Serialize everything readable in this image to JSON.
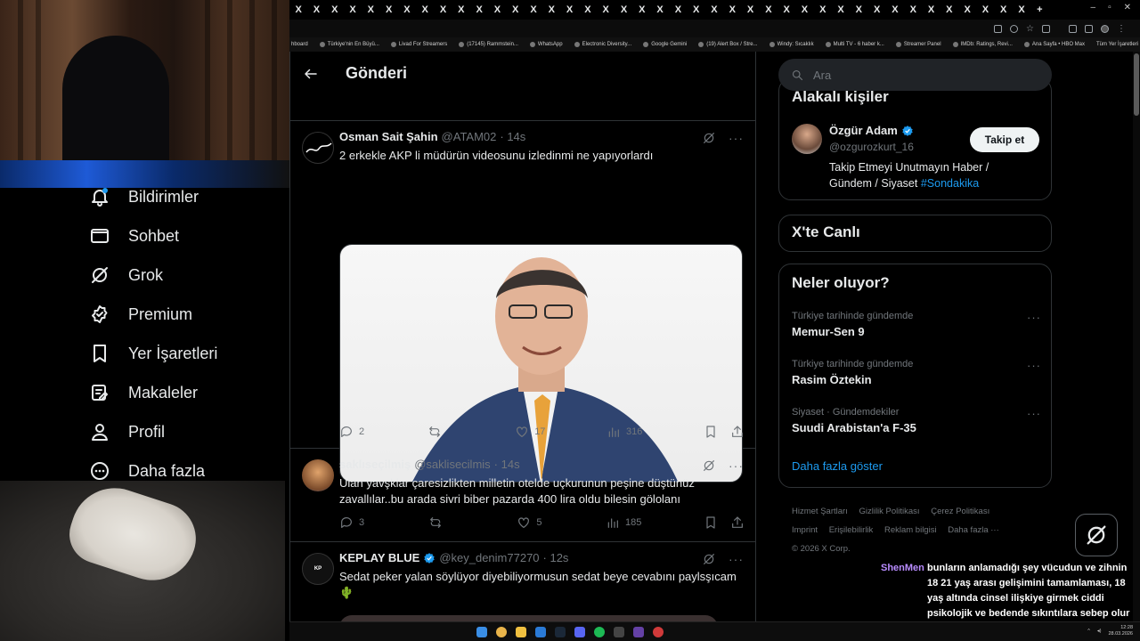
{
  "browser": {
    "tab_close_glyph": "X",
    "new_tab_glyph": "+",
    "window_controls": [
      "–",
      "▫",
      "✕"
    ],
    "bookmarks": [
      "hboard",
      "Türkiye'nin En Büyü...",
      "Livad For Streamers",
      "(17145) Rammstein...",
      "WhatsApp",
      "Electronic Diversity...",
      "Google Gemini",
      "(19) Alert Box / Stre...",
      "Windy: Sıcaklık",
      "Multi TV - 6 haber k...",
      "Streamer Panel",
      "IMDb: Ratings, Revi...",
      "Ana Sayfa • HBO Max"
    ],
    "bookmarks_all": "Tüm Yer İşaretleri"
  },
  "nav": {
    "items": [
      {
        "label": "Bildirimler",
        "icon": "bell-icon"
      },
      {
        "label": "Sohbet",
        "icon": "envelope-icon"
      },
      {
        "label": "Grok",
        "icon": "grok-icon"
      },
      {
        "label": "Premium",
        "icon": "premium-icon"
      },
      {
        "label": "Yer İşaretleri",
        "icon": "bookmark-icon"
      },
      {
        "label": "Makaleler",
        "icon": "articles-icon"
      },
      {
        "label": "Profil",
        "icon": "person-icon"
      },
      {
        "label": "Daha fazla",
        "icon": "more-circle-icon"
      }
    ]
  },
  "header": {
    "title": "Gönderi"
  },
  "tweets": [
    {
      "name": "Osman Sait Şahin",
      "handle": "@ATAM02",
      "time": "· 14s",
      "verified": false,
      "text": "2 erkekle AKP li müdürün videosunu izledinmi ne yapıyorlardı",
      "replies": "2",
      "reposts": "",
      "likes": "17",
      "views": "316"
    },
    {
      "name": "saklıseçilmiş",
      "handle": "@saklisecilmis",
      "time": "· 14s",
      "verified": false,
      "text": "Ulan yavşklar çaresizlikten milletin otelde  uçkurunun peşine düştünüz zavallılar..bu arada sivri biber pazarda 400 lira oldu bilesin gölolanı",
      "replies": "3",
      "reposts": "",
      "likes": "5",
      "views": "185"
    },
    {
      "name": "KEPLAY BLUE",
      "handle": "@key_denim77270",
      "time": "· 12s",
      "verified": true,
      "text": "Sedat peker yalan söylüyor diyebiliyormusun sedat beye cevabını paylsşıcam 🌵"
    }
  ],
  "right": {
    "search_placeholder": "Ara",
    "who_to_follow": {
      "title": "Alakalı kişiler",
      "name": "Özgür Adam",
      "handle": "@ozgurozkurt_16",
      "follow_label": "Takip et",
      "bio": "Takip Etmeyi Unutmayın Haber / Gündem / Siyaset",
      "hashtag": "#Sondakika"
    },
    "live": {
      "title": "X'te Canlı"
    },
    "trends": {
      "title": "Neler oluyor?",
      "items": [
        {
          "context": "Türkiye tarihinde gündemde",
          "name": "Memur-Sen 9"
        },
        {
          "context": "Türkiye tarihinde gündemde",
          "name": "Rasim Öztekin"
        },
        {
          "context": "Siyaset · Gündemdekiler",
          "name": "Suudi Arabistan'a F-35"
        }
      ],
      "show_more": "Daha fazla göster"
    },
    "footer": {
      "links": [
        "Hizmet Şartları",
        "Gizlilik Politikası",
        "Çerez Politikası",
        "Imprint",
        "Erişilebilirlik",
        "Reklam bilgisi",
        "Daha fazla ···"
      ],
      "copyright": "© 2026 X Corp."
    }
  },
  "chat": {
    "user": "ShenMen",
    "message": "bunların anlamadığı şey vücudun ve zihnin 18 21 yaş arası gelişimini tamamlaması, 18 yaş altında cinsel ilişkiye girmek ciddi psikolojik ve bedende sıkıntılara sebep olur daha bunu bile anlamıyorlar"
  },
  "taskbar": {
    "time": "12:28",
    "date": "28.03.2026"
  },
  "colors": {
    "accent": "#1d9bf0",
    "muted": "#71767b",
    "chat_user": "#b98cff"
  }
}
